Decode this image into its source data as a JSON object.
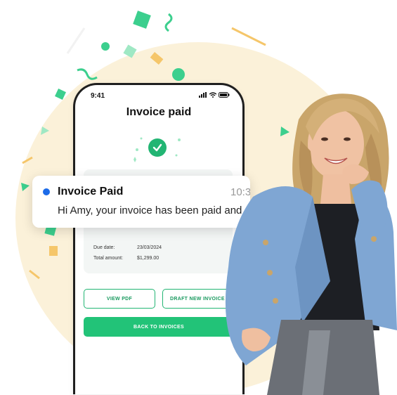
{
  "phone": {
    "time": "9:41",
    "title": "Invoice paid",
    "due_label": "Due date:",
    "due_value": "23/03/2024",
    "total_label": "Total amount:",
    "total_value": "$1,299.00",
    "view_pdf": "VIEW PDF",
    "draft_new": "DRAFT NEW INVOICE",
    "back": "BACK TO INVOICES"
  },
  "notification": {
    "title": "Invoice Paid",
    "time": "10:30",
    "body": "Hi Amy, your invoice has been paid and"
  },
  "colors": {
    "accent": "#22c378",
    "notif_dot": "#1c6be8",
    "background": "#fbf1d9",
    "blazer": "#7fa6d3"
  }
}
